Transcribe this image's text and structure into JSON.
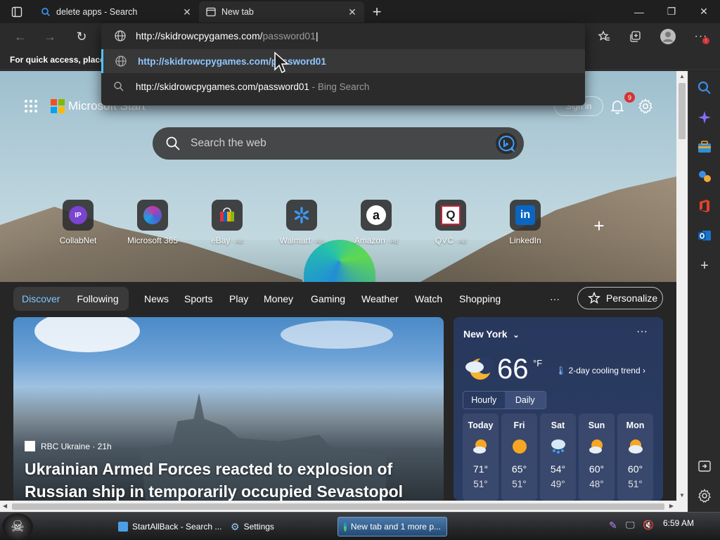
{
  "tabs": [
    {
      "title": "delete apps - Search",
      "active": false
    },
    {
      "title": "New tab",
      "active": true
    }
  ],
  "address": {
    "typed_host": "http://skidrowcpygames.com/",
    "typed_path": "password01",
    "suggestions": [
      {
        "text": "http://skidrowcpygames.com/password01",
        "suffix": "",
        "type": "url"
      },
      {
        "text": "http://skidrowcpygames.com/password01",
        "suffix": " - Bing Search",
        "type": "search"
      }
    ]
  },
  "favbar": {
    "text": "For quick access, place y"
  },
  "page": {
    "brand": "Microsoft Start",
    "signin": "Sign in",
    "notification_count": "9",
    "search_placeholder": "Search the web",
    "tiles": [
      {
        "label": "CollabNet",
        "ad": "",
        "icon": "IP"
      },
      {
        "label": "Microsoft 365",
        "ad": "",
        "icon": "m365"
      },
      {
        "label": "eBay",
        "ad": " · Ad",
        "icon": "ebay"
      },
      {
        "label": "Walmart",
        "ad": " · Ad",
        "icon": "walmart"
      },
      {
        "label": "Amazon",
        "ad": " · Ad",
        "icon": "a"
      },
      {
        "label": "QVC",
        "ad": " · Ad",
        "icon": "Q"
      },
      {
        "label": "LinkedIn",
        "ad": "",
        "icon": "in"
      }
    ]
  },
  "feed": {
    "pills": [
      "Discover",
      "Following"
    ],
    "nav": [
      "News",
      "Sports",
      "Play",
      "Money",
      "Gaming",
      "Weather",
      "Watch",
      "Shopping"
    ],
    "more": "···",
    "personalize": "Personalize",
    "hero": {
      "source": "RBC Ukraine · 21h",
      "headline": "Ukrainian Armed Forces reacted to explosion of Russian ship in temporarily occupied Sevastopol"
    }
  },
  "weather": {
    "city": "New York",
    "temp": "66",
    "unit": "°F",
    "trend": "2-day cooling trend",
    "toggle": [
      "Hourly",
      "Daily"
    ],
    "days": [
      {
        "name": "Today",
        "hi": "71°",
        "lo": "51°",
        "icon": "sun-cloud"
      },
      {
        "name": "Fri",
        "hi": "65°",
        "lo": "51°",
        "icon": "sun"
      },
      {
        "name": "Sat",
        "hi": "54°",
        "lo": "49°",
        "icon": "rain"
      },
      {
        "name": "Sun",
        "hi": "60°",
        "lo": "48°",
        "icon": "sun-cloud"
      },
      {
        "name": "Mon",
        "hi": "60°",
        "lo": "51°",
        "icon": "sun-cloud"
      }
    ]
  },
  "taskbar": {
    "items": [
      {
        "label": "StartAllBack - Search ...",
        "active": false
      },
      {
        "label": "Settings",
        "active": false
      },
      {
        "label": "New tab and 1 more p...",
        "active": true
      }
    ],
    "clock": "6:59 AM"
  },
  "colors": {
    "accent": "#4cc2ff",
    "badge": "#d13438"
  }
}
